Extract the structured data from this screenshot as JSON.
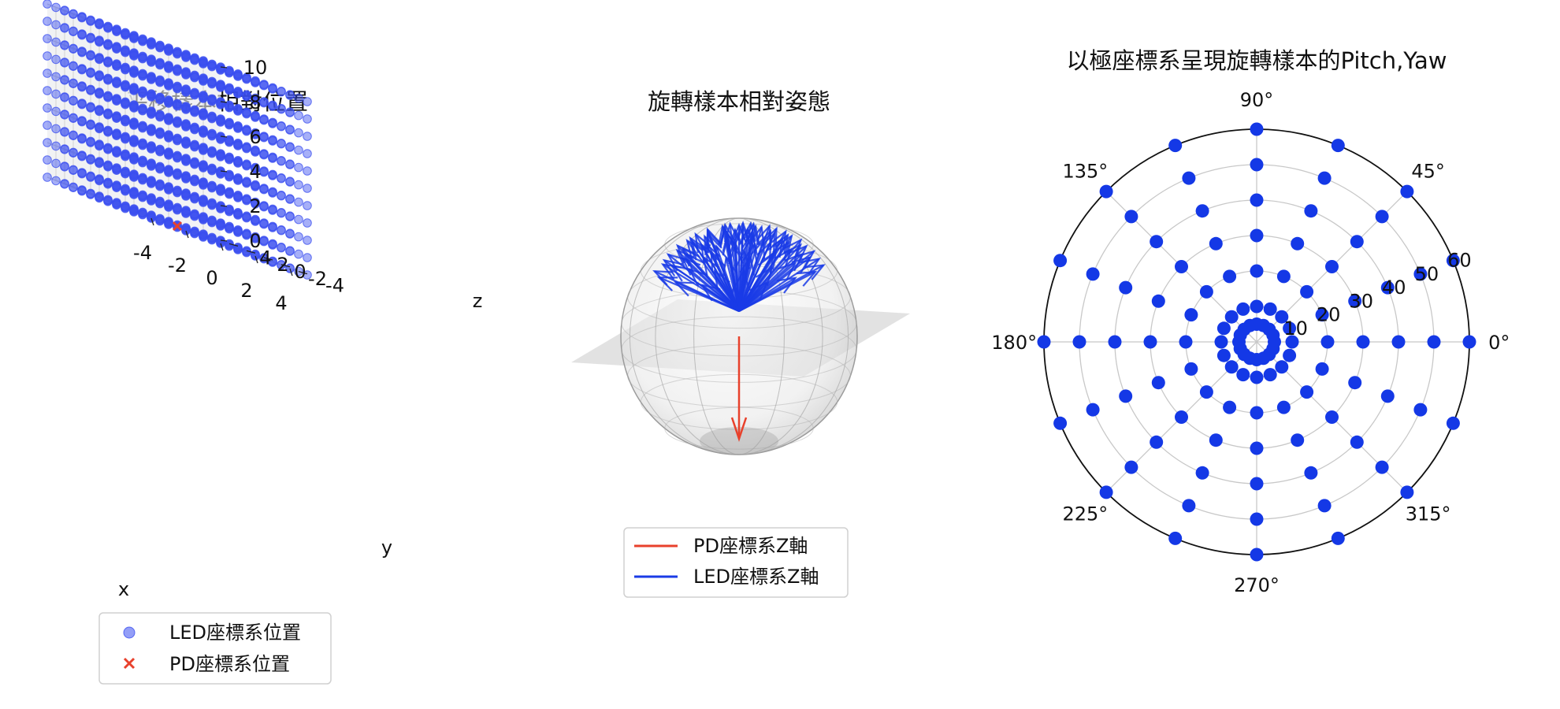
{
  "chart_data": [
    {
      "type": "scatter",
      "subtype": "3d",
      "title": "平移樣本相對位置",
      "xlabel": "x",
      "ylabel": "y",
      "zlabel": "z",
      "xlim": [
        -5,
        5
      ],
      "ylim": [
        -5,
        5
      ],
      "zlim": [
        0,
        10
      ],
      "xticks": [
        "-4",
        "-2",
        "0",
        "2",
        "4"
      ],
      "yticks": [
        "-4",
        "-2",
        "0",
        "2",
        "4"
      ],
      "zticks": [
        "0",
        "2",
        "4",
        "6",
        "8",
        "10"
      ],
      "grid": true,
      "legend_position": "bottom",
      "series": [
        {
          "name": "LED座標系位置",
          "marker": "circle",
          "color": "#3a4ef0",
          "grid_points": {
            "x": [
              -5,
              -4,
              -3,
              -2,
              -1,
              0,
              1,
              2,
              3,
              4,
              5
            ],
            "y": [
              -5,
              -4,
              -3,
              -2,
              -1,
              0,
              1,
              2,
              3,
              4,
              5
            ],
            "z": [
              0,
              1,
              2,
              3,
              4,
              5,
              6,
              7,
              8,
              9,
              10
            ]
          }
        },
        {
          "name": "PD座標系位置",
          "marker": "x",
          "color": "#e8412c",
          "points": [
            [
              0,
              0,
              0
            ]
          ]
        }
      ]
    },
    {
      "type": "vector-field",
      "subtype": "3d-sphere",
      "title": "旋轉樣本相對姿態",
      "legend_position": "bottom",
      "series": [
        {
          "name": "PD座標系Z軸",
          "color": "#e8412c",
          "vector": [
            0,
            0,
            -1
          ]
        },
        {
          "name": "LED座標系Z軸",
          "color": "#1a3be6",
          "pitch_values": [
            10,
            20,
            30,
            40,
            50,
            60
          ],
          "yaw_step_degrees": 45
        }
      ]
    },
    {
      "type": "scatter",
      "subtype": "polar",
      "title": "以極座標系呈現旋轉樣本的Pitch,Yaw",
      "angle_ticks": [
        "0°",
        "45°",
        "90°",
        "135°",
        "180°",
        "225°",
        "270°",
        "315°"
      ],
      "radial_ticks": [
        "10",
        "20",
        "30",
        "40",
        "50",
        "60"
      ],
      "rlim": [
        0,
        60
      ],
      "grid": true,
      "color": "#1438e6",
      "series": [
        {
          "name": "Pitch,Yaw",
          "angles_deg": [
            0,
            22.5,
            45,
            67.5,
            90,
            112.5,
            135,
            157.5,
            180,
            202.5,
            225,
            247.5,
            270,
            292.5,
            315,
            337.5
          ],
          "radii": [
            5,
            10,
            20,
            30,
            40,
            50,
            60
          ]
        }
      ]
    }
  ]
}
